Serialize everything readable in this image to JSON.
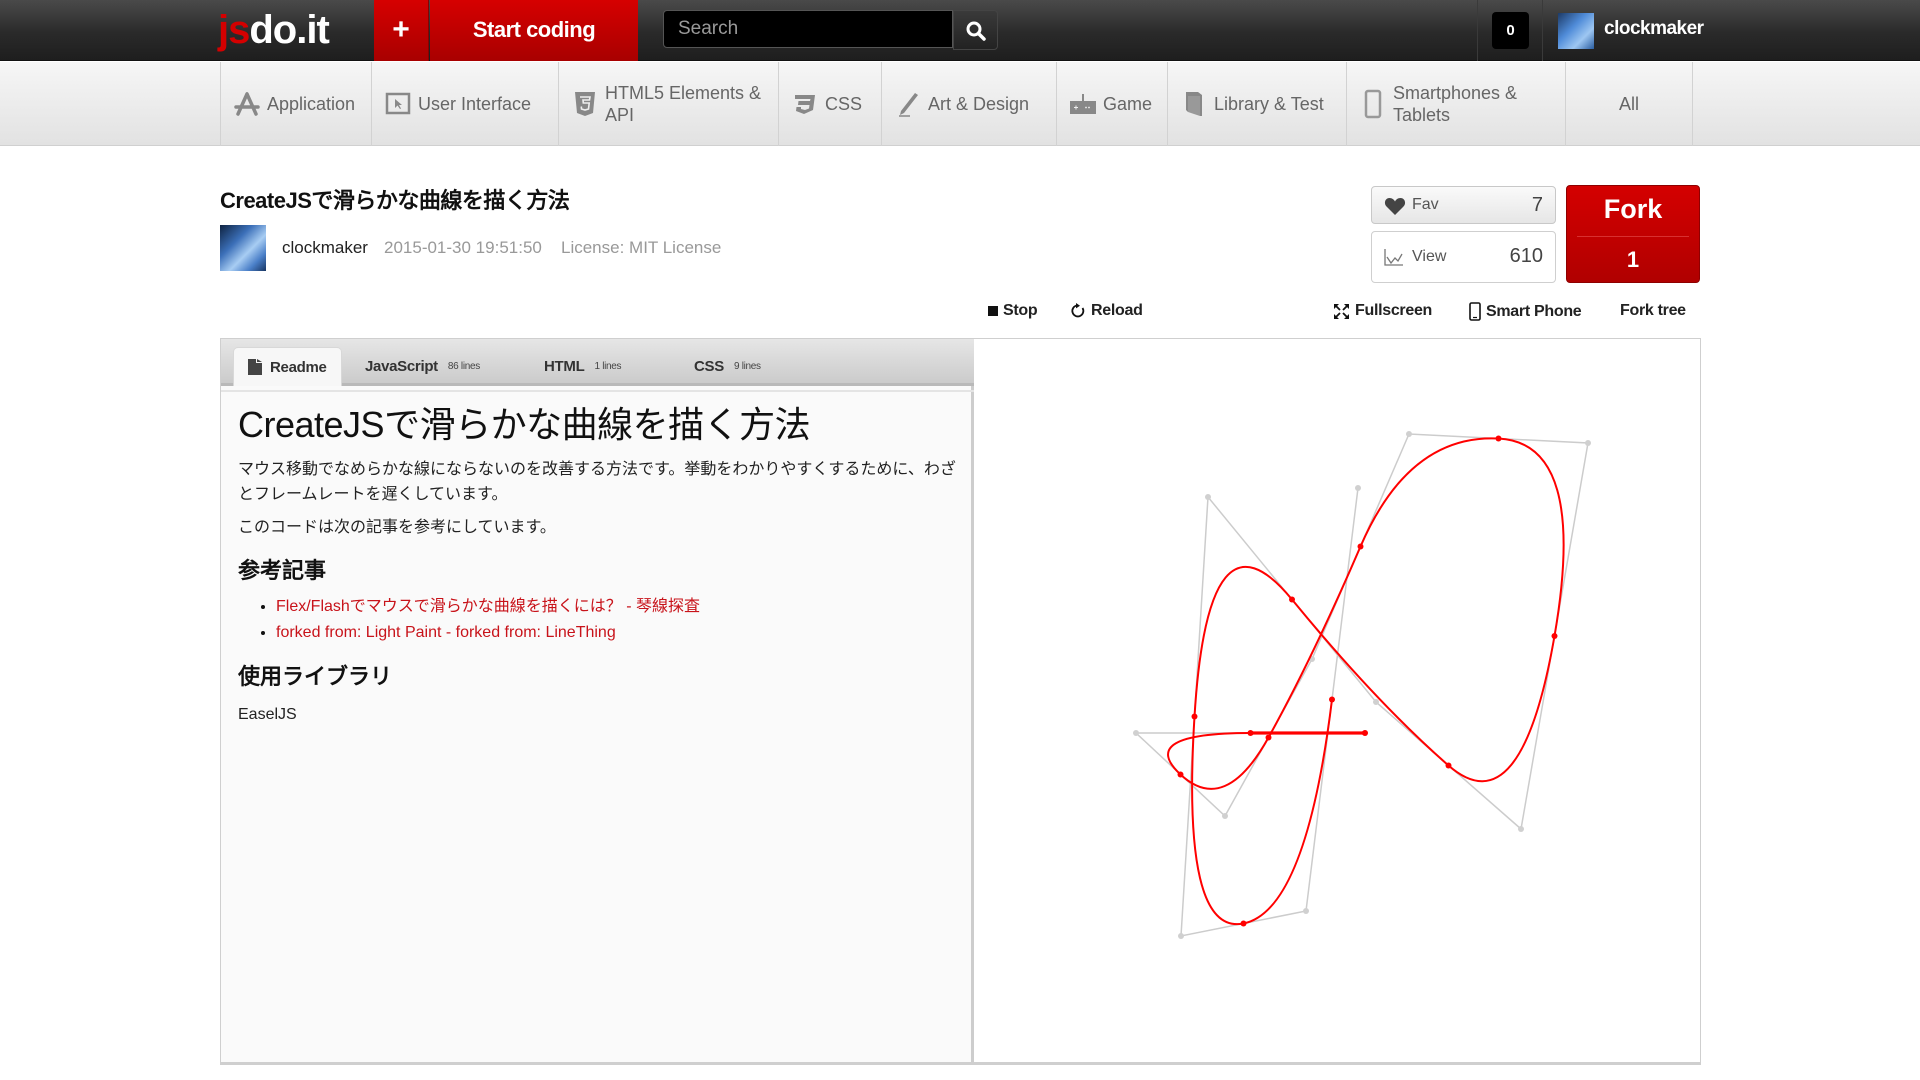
{
  "header": {
    "logo_js": "js",
    "logo_rest": "do.it",
    "plus_label": "+",
    "start_coding_label": "Start coding",
    "search_placeholder": "Search",
    "search_icon": "magnifier-icon",
    "notification_count": "0",
    "username": "clockmaker"
  },
  "categories": [
    {
      "label": "Application",
      "icon": "app-store-icon"
    },
    {
      "label": "User Interface",
      "icon": "cursor-window-icon"
    },
    {
      "label": "HTML5 Elements & API",
      "icon": "html5-icon"
    },
    {
      "label": "CSS",
      "icon": "css3-icon"
    },
    {
      "label": "Art & Design",
      "icon": "pen-icon"
    },
    {
      "label": "Game",
      "icon": "gamepad-icon"
    },
    {
      "label": "Library & Test",
      "icon": "book-icon"
    },
    {
      "label": "Smartphones & Tablets",
      "icon": "smartphone-icon"
    },
    {
      "label": "All",
      "icon": ""
    }
  ],
  "project": {
    "title": "CreateJSで滑らかな曲線を描く方法",
    "author": "clockmaker",
    "date": "2015-01-30 19:51:50",
    "license": "License: MIT License",
    "fav_label": "Fav",
    "fav_count": "7",
    "view_label": "View",
    "view_count": "610",
    "fork_label": "Fork",
    "fork_count": "1"
  },
  "tools": {
    "stop": "Stop",
    "reload": "Reload",
    "fullscreen": "Fullscreen",
    "smartphone": "Smart Phone",
    "fork_tree": "Fork tree"
  },
  "tabs": [
    {
      "label": "Readme",
      "lines": ""
    },
    {
      "label": "JavaScript",
      "lines": "86 lines"
    },
    {
      "label": "HTML",
      "lines": "1 lines"
    },
    {
      "label": "CSS",
      "lines": "9 lines"
    }
  ],
  "readme": {
    "heading": "CreateJSで滑らかな曲線を描く方法",
    "intro": "マウス移動でなめらかな線にならないのを改善する方法です。挙動をわかりやすくするために、わざとフレームレートを遅くしています。",
    "reference_note": "このコードは次の記事を参考にしています。",
    "refs_heading": "参考記事",
    "links": [
      "Flex/Flashでマウスで滑らかな曲線を描くには？ - 琴線探査",
      "forked from: Light Paint - forked from: LineThing"
    ],
    "libs_heading": "使用ライブラリ",
    "libs": "EaselJS"
  },
  "colors": {
    "brand_red": "#d40000",
    "curve_red": "#ff0000",
    "guide_gray": "#cccccc",
    "link_red": "#c8131a"
  }
}
